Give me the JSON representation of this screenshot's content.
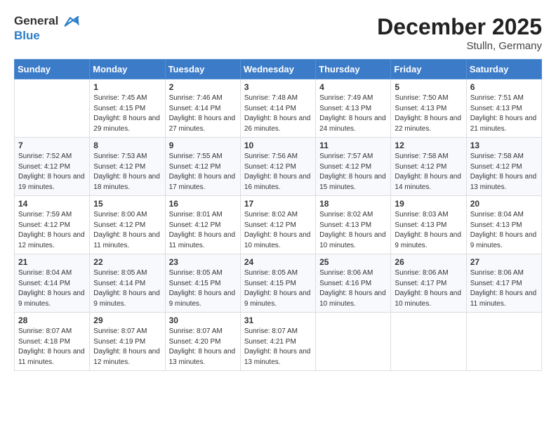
{
  "header": {
    "logo_line1": "General",
    "logo_line2": "Blue",
    "month": "December 2025",
    "location": "Stulln, Germany"
  },
  "weekdays": [
    "Sunday",
    "Monday",
    "Tuesday",
    "Wednesday",
    "Thursday",
    "Friday",
    "Saturday"
  ],
  "weeks": [
    [
      {
        "day": "",
        "sunrise": "",
        "sunset": "",
        "daylight": ""
      },
      {
        "day": "1",
        "sunrise": "Sunrise: 7:45 AM",
        "sunset": "Sunset: 4:15 PM",
        "daylight": "Daylight: 8 hours and 29 minutes."
      },
      {
        "day": "2",
        "sunrise": "Sunrise: 7:46 AM",
        "sunset": "Sunset: 4:14 PM",
        "daylight": "Daylight: 8 hours and 27 minutes."
      },
      {
        "day": "3",
        "sunrise": "Sunrise: 7:48 AM",
        "sunset": "Sunset: 4:14 PM",
        "daylight": "Daylight: 8 hours and 26 minutes."
      },
      {
        "day": "4",
        "sunrise": "Sunrise: 7:49 AM",
        "sunset": "Sunset: 4:13 PM",
        "daylight": "Daylight: 8 hours and 24 minutes."
      },
      {
        "day": "5",
        "sunrise": "Sunrise: 7:50 AM",
        "sunset": "Sunset: 4:13 PM",
        "daylight": "Daylight: 8 hours and 22 minutes."
      },
      {
        "day": "6",
        "sunrise": "Sunrise: 7:51 AM",
        "sunset": "Sunset: 4:13 PM",
        "daylight": "Daylight: 8 hours and 21 minutes."
      }
    ],
    [
      {
        "day": "7",
        "sunrise": "Sunrise: 7:52 AM",
        "sunset": "Sunset: 4:12 PM",
        "daylight": "Daylight: 8 hours and 19 minutes."
      },
      {
        "day": "8",
        "sunrise": "Sunrise: 7:53 AM",
        "sunset": "Sunset: 4:12 PM",
        "daylight": "Daylight: 8 hours and 18 minutes."
      },
      {
        "day": "9",
        "sunrise": "Sunrise: 7:55 AM",
        "sunset": "Sunset: 4:12 PM",
        "daylight": "Daylight: 8 hours and 17 minutes."
      },
      {
        "day": "10",
        "sunrise": "Sunrise: 7:56 AM",
        "sunset": "Sunset: 4:12 PM",
        "daylight": "Daylight: 8 hours and 16 minutes."
      },
      {
        "day": "11",
        "sunrise": "Sunrise: 7:57 AM",
        "sunset": "Sunset: 4:12 PM",
        "daylight": "Daylight: 8 hours and 15 minutes."
      },
      {
        "day": "12",
        "sunrise": "Sunrise: 7:58 AM",
        "sunset": "Sunset: 4:12 PM",
        "daylight": "Daylight: 8 hours and 14 minutes."
      },
      {
        "day": "13",
        "sunrise": "Sunrise: 7:58 AM",
        "sunset": "Sunset: 4:12 PM",
        "daylight": "Daylight: 8 hours and 13 minutes."
      }
    ],
    [
      {
        "day": "14",
        "sunrise": "Sunrise: 7:59 AM",
        "sunset": "Sunset: 4:12 PM",
        "daylight": "Daylight: 8 hours and 12 minutes."
      },
      {
        "day": "15",
        "sunrise": "Sunrise: 8:00 AM",
        "sunset": "Sunset: 4:12 PM",
        "daylight": "Daylight: 8 hours and 11 minutes."
      },
      {
        "day": "16",
        "sunrise": "Sunrise: 8:01 AM",
        "sunset": "Sunset: 4:12 PM",
        "daylight": "Daylight: 8 hours and 11 minutes."
      },
      {
        "day": "17",
        "sunrise": "Sunrise: 8:02 AM",
        "sunset": "Sunset: 4:12 PM",
        "daylight": "Daylight: 8 hours and 10 minutes."
      },
      {
        "day": "18",
        "sunrise": "Sunrise: 8:02 AM",
        "sunset": "Sunset: 4:13 PM",
        "daylight": "Daylight: 8 hours and 10 minutes."
      },
      {
        "day": "19",
        "sunrise": "Sunrise: 8:03 AM",
        "sunset": "Sunset: 4:13 PM",
        "daylight": "Daylight: 8 hours and 9 minutes."
      },
      {
        "day": "20",
        "sunrise": "Sunrise: 8:04 AM",
        "sunset": "Sunset: 4:13 PM",
        "daylight": "Daylight: 8 hours and 9 minutes."
      }
    ],
    [
      {
        "day": "21",
        "sunrise": "Sunrise: 8:04 AM",
        "sunset": "Sunset: 4:14 PM",
        "daylight": "Daylight: 8 hours and 9 minutes."
      },
      {
        "day": "22",
        "sunrise": "Sunrise: 8:05 AM",
        "sunset": "Sunset: 4:14 PM",
        "daylight": "Daylight: 8 hours and 9 minutes."
      },
      {
        "day": "23",
        "sunrise": "Sunrise: 8:05 AM",
        "sunset": "Sunset: 4:15 PM",
        "daylight": "Daylight: 8 hours and 9 minutes."
      },
      {
        "day": "24",
        "sunrise": "Sunrise: 8:05 AM",
        "sunset": "Sunset: 4:15 PM",
        "daylight": "Daylight: 8 hours and 9 minutes."
      },
      {
        "day": "25",
        "sunrise": "Sunrise: 8:06 AM",
        "sunset": "Sunset: 4:16 PM",
        "daylight": "Daylight: 8 hours and 10 minutes."
      },
      {
        "day": "26",
        "sunrise": "Sunrise: 8:06 AM",
        "sunset": "Sunset: 4:17 PM",
        "daylight": "Daylight: 8 hours and 10 minutes."
      },
      {
        "day": "27",
        "sunrise": "Sunrise: 8:06 AM",
        "sunset": "Sunset: 4:17 PM",
        "daylight": "Daylight: 8 hours and 11 minutes."
      }
    ],
    [
      {
        "day": "28",
        "sunrise": "Sunrise: 8:07 AM",
        "sunset": "Sunset: 4:18 PM",
        "daylight": "Daylight: 8 hours and 11 minutes."
      },
      {
        "day": "29",
        "sunrise": "Sunrise: 8:07 AM",
        "sunset": "Sunset: 4:19 PM",
        "daylight": "Daylight: 8 hours and 12 minutes."
      },
      {
        "day": "30",
        "sunrise": "Sunrise: 8:07 AM",
        "sunset": "Sunset: 4:20 PM",
        "daylight": "Daylight: 8 hours and 13 minutes."
      },
      {
        "day": "31",
        "sunrise": "Sunrise: 8:07 AM",
        "sunset": "Sunset: 4:21 PM",
        "daylight": "Daylight: 8 hours and 13 minutes."
      },
      {
        "day": "",
        "sunrise": "",
        "sunset": "",
        "daylight": ""
      },
      {
        "day": "",
        "sunrise": "",
        "sunset": "",
        "daylight": ""
      },
      {
        "day": "",
        "sunrise": "",
        "sunset": "",
        "daylight": ""
      }
    ]
  ]
}
